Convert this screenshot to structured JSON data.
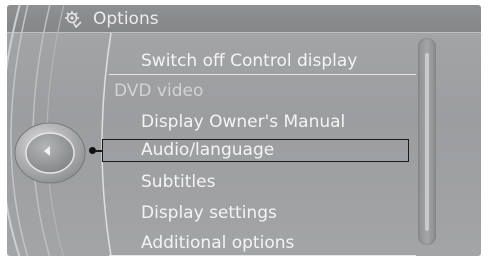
{
  "header": {
    "title": "Options",
    "icon": "options-gear-icon"
  },
  "menu": {
    "items": [
      {
        "label": "Switch off Control display",
        "enabled": true
      },
      {
        "label": "DVD video",
        "enabled": false
      },
      {
        "label": "Display Owner's Manual",
        "enabled": true
      },
      {
        "label": "Audio/language",
        "enabled": true,
        "selected": true
      },
      {
        "label": "Subtitles",
        "enabled": true
      },
      {
        "label": "Display settings",
        "enabled": true
      },
      {
        "label": "Additional options",
        "enabled": true
      }
    ]
  },
  "controller": {
    "icon": "left-arrow-icon"
  },
  "colors": {
    "background": "#9c9da0",
    "header": "#8a8b8d",
    "text": "#f4f4f5",
    "selection_border": "#1a1a1a"
  }
}
